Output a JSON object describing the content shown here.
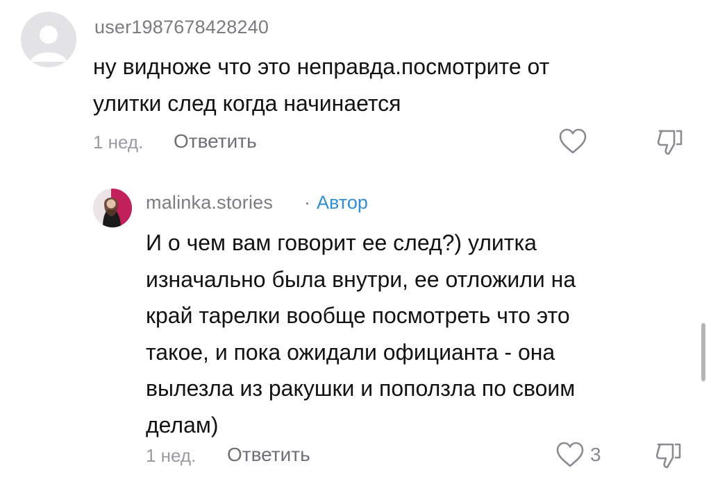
{
  "comments": [
    {
      "username": "user1987678428240",
      "lines": [
        "ну видноже что это неправда.посмотрите от",
        "улитки след когда начинается"
      ],
      "time": "1 нед.",
      "reply_label": "Ответить",
      "like_count": ""
    }
  ],
  "reply": {
    "username": "malinka.stories",
    "separator": "·",
    "author_badge": "Автор",
    "lines": [
      "И о чем вам говорит ее след?) улитка",
      "изначально была внутри, ее отложили на",
      "край тарелки вообще посмотреть что это",
      "такое, и пока ожидали официанта - она",
      "вылезла из ракушки и поползла по своим",
      "делам)"
    ],
    "time": "1 нед.",
    "reply_label": "Ответить",
    "like_count": "3"
  },
  "colors": {
    "text": "#121212",
    "muted": "#7b7b80",
    "author_accent": "#2f8fd6"
  },
  "icons": {
    "like": "heart-outline-icon",
    "dislike": "thumbs-down-outline-icon"
  }
}
